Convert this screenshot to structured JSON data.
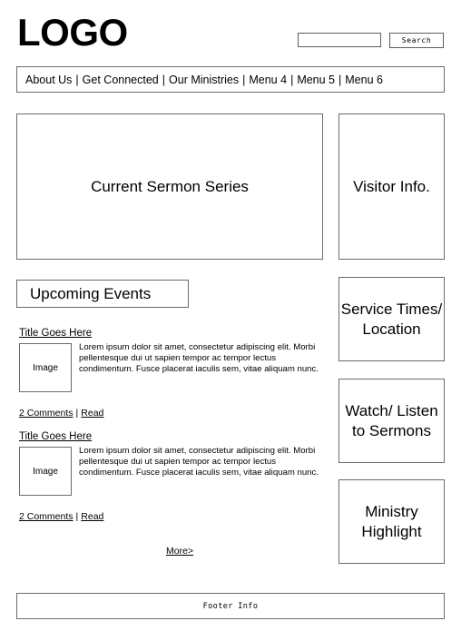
{
  "header": {
    "logo_text": "LOGO",
    "search": {
      "value": "",
      "placeholder": "",
      "button_label": "Search"
    }
  },
  "nav": {
    "separator": "|",
    "items": [
      {
        "label": "About Us"
      },
      {
        "label": "Get Connected"
      },
      {
        "label": "Our Ministries"
      },
      {
        "label": "Menu 4"
      },
      {
        "label": "Menu 5"
      },
      {
        "label": "Menu 6"
      }
    ]
  },
  "main": {
    "hero": {
      "label": "Current Sermon Series"
    },
    "events_heading": {
      "label": "Upcoming Events"
    },
    "articles": [
      {
        "title": "Title Goes Here",
        "thumb_label": "Image",
        "excerpt": "Lorem ipsum dolor sit amet, consectetur adipiscing elit. Morbi pellentesque dui ut sapien tempor ac tempor lectus condimentum. Fusce placerat iaculis sem, vitae aliquam nunc.",
        "comments_label": "2 Comments",
        "read_label": "Read"
      },
      {
        "title": "Title Goes Here",
        "thumb_label": "Image",
        "excerpt": "Lorem ipsum dolor sit amet, consectetur adipiscing elit. Morbi pellentesque dui ut sapien tempor ac tempor lectus condimentum. Fusce placerat iaculis sem, vitae aliquam nunc.",
        "comments_label": "2 Comments",
        "read_label": "Read"
      }
    ],
    "more_label": "More>"
  },
  "sidebar": {
    "boxes": [
      {
        "label": "Visitor Info."
      },
      {
        "label": "Service Times/ Location"
      },
      {
        "label": "Watch/ Listen to Sermons"
      },
      {
        "label": "Ministry Highlight"
      }
    ]
  },
  "footer": {
    "label": "Footer Info"
  },
  "colors": {
    "border": "#6b6b6b",
    "text": "#000000",
    "background": "#ffffff"
  }
}
